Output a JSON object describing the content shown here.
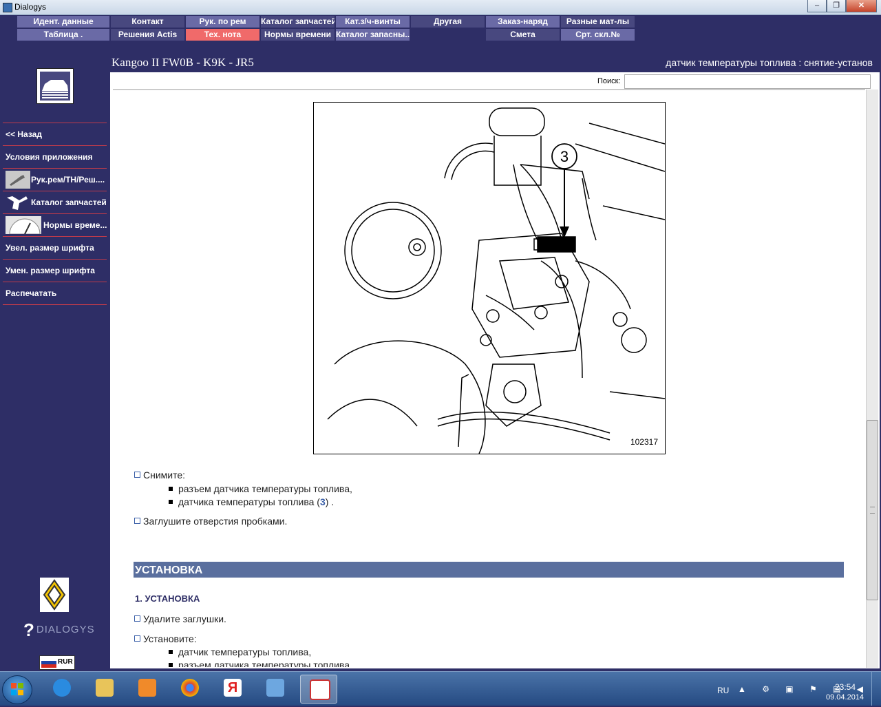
{
  "window": {
    "title": "Dialogys"
  },
  "menu": {
    "row1": [
      "Идент. данные",
      "Контакт",
      "Рук. по рем",
      "Каталог запчастей",
      "Кат.з/ч-винты",
      "Другая",
      "Заказ-наряд",
      "Разные мат-лы"
    ],
    "row2": [
      "Таблица .",
      "Решения Actis",
      "Тех. нота",
      "Нормы времени",
      "Каталог запасны...",
      "Смета",
      "Срт. скл.№"
    ],
    "active": "Тех. нота"
  },
  "header": {
    "title": "Kangoo II FW0B - K9K - JR5",
    "subtitle": "датчик температуры топлива : снятие-установ"
  },
  "search": {
    "label": "Поиск:",
    "value": ""
  },
  "sidebar": {
    "items": [
      {
        "label": "<< Назад"
      },
      {
        "label": "Условия приложения"
      },
      {
        "label": "Рук.рем/ТН/Реш....",
        "icon": "wrench-icon"
      },
      {
        "label": "Каталог запчастей",
        "icon": "parts-icon"
      },
      {
        "label": "Нормы време...",
        "icon": "gauge-icon"
      },
      {
        "label": "Увел. размер шрифта"
      },
      {
        "label": "Умен. размер шрифта"
      },
      {
        "label": "Распечатать"
      }
    ],
    "brand": "DIALOGYS",
    "currency": "RUR"
  },
  "figure": {
    "callout": "3",
    "number": "102317"
  },
  "content": {
    "step1": "Снимите:",
    "step1_items": [
      "разъем датчика температуры топлива,",
      "датчика температуры топлива ("
    ],
    "step1_ref": "3",
    "step1_tail": ") .",
    "step2": "Заглушите отверстия пробками.",
    "section_title": "УСТАНОВКА",
    "subsection_title": "1. УСТАНОВКА",
    "step3": "Удалите заглушки.",
    "step4": "Установите:",
    "step4_items": [
      "датчик температуры топлива,",
      "разъем датчика температуры топлива,"
    ]
  },
  "taskbar": {
    "lang": "RU",
    "time": "23:54",
    "date": "09.04.2014"
  }
}
